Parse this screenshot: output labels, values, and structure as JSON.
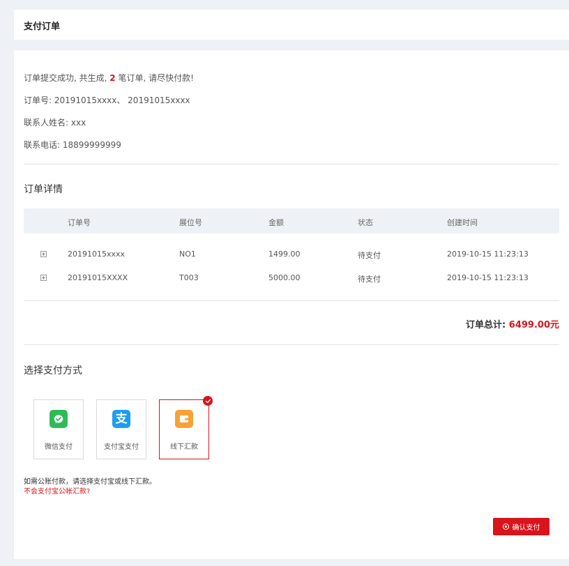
{
  "header": {
    "title": "支付订单"
  },
  "summary": {
    "success_prefix": "订单提交成功, 共生成, ",
    "order_count": "2",
    "success_suffix": " 笔订单, 请尽快付款!",
    "order_numbers_label": "订单号:",
    "order_numbers": "20191015xxxx、 20191015xxxx",
    "contact_name_label": "联系人姓名:",
    "contact_name": "xxx",
    "contact_phone_label": "联系电话:",
    "contact_phone": "18899999999"
  },
  "details": {
    "title": "订单详情",
    "columns": [
      "订单号",
      "展位号",
      "金额",
      "状态",
      "创建时间"
    ],
    "rows": [
      {
        "order_no": "20191015xxxx",
        "booth": "NO1",
        "amount": "1499.00",
        "status": "待支付",
        "created": "2019-10-15 11:23:13"
      },
      {
        "order_no": "20191015XXXX",
        "booth": "T003",
        "amount": "5000.00",
        "status": "待支付",
        "created": "2019-10-15 11:23:13"
      }
    ]
  },
  "total": {
    "label": "订单总计:",
    "amount": "6499.00元"
  },
  "payment": {
    "title": "选择支付方式",
    "options": [
      {
        "label": "微信支付",
        "icon": "wechat-icon",
        "color": "#2ebb56",
        "selected": false
      },
      {
        "label": "支付宝支付",
        "icon": "alipay-icon",
        "color": "#1a9ff0",
        "selected": false
      },
      {
        "label": "线下汇款",
        "icon": "wallet-icon",
        "color": "#f7a234",
        "selected": true
      }
    ],
    "hint": "如需公账付款，请选择支付宝或线下汇款。",
    "help_link": "不会支付宝公帐汇款?"
  },
  "confirm_button": "确认支付",
  "colors": {
    "accent": "#d9141b",
    "background": "#eef1f5"
  }
}
